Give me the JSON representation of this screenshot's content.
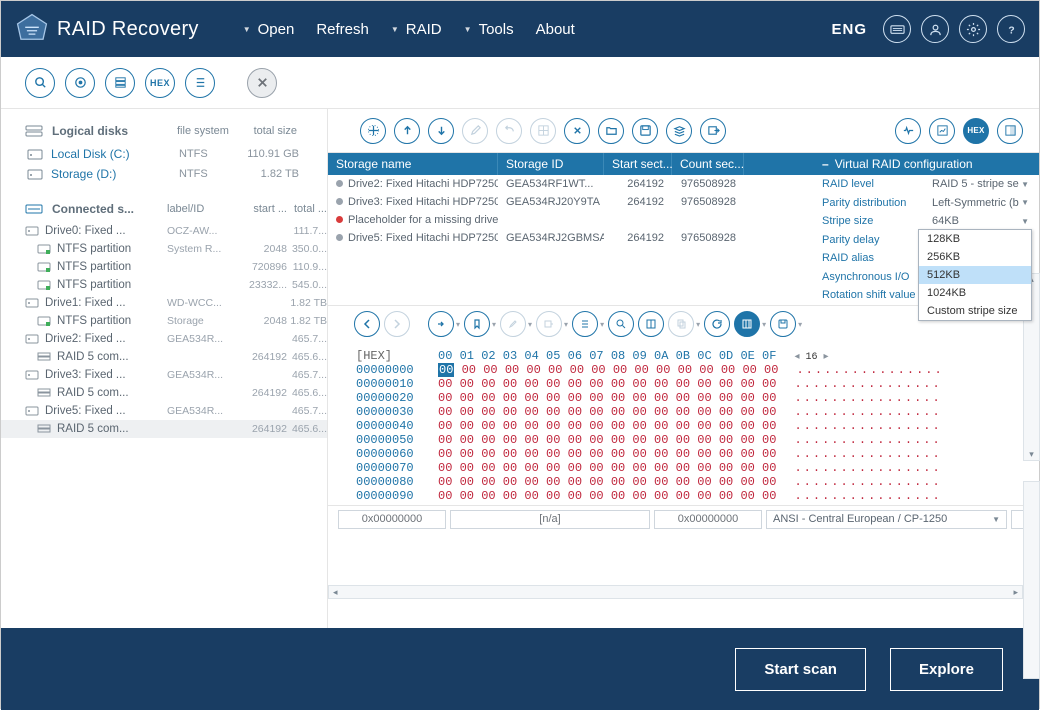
{
  "app": {
    "title": "RAID Recovery",
    "lang": "ENG"
  },
  "menu": {
    "open": "Open",
    "refresh": "Refresh",
    "raid": "RAID",
    "tools": "Tools",
    "about": "About"
  },
  "sidebar": {
    "logical_title": "Logical disks",
    "fs_col": "file system",
    "sz_col": "total size",
    "logical": [
      {
        "name": "Local Disk (C:)",
        "fs": "NTFS",
        "size": "110.91 GB"
      },
      {
        "name": "Storage (D:)",
        "fs": "NTFS",
        "size": "1.82 TB"
      }
    ],
    "connected_title": "Connected s...",
    "lid_col": "label/ID",
    "ss_col": "start ...",
    "tot_col": "total ...",
    "items": [
      {
        "t": "d",
        "name": "Drive0: Fixed ...",
        "id": "OCZ-AW...",
        "ss": "",
        "sz": "111.7..."
      },
      {
        "t": "p",
        "name": "NTFS partition",
        "id": "System R...",
        "ss": "2048",
        "sz": "350.0..."
      },
      {
        "t": "p",
        "name": "NTFS partition",
        "id": "",
        "ss": "720896",
        "sz": "110.9..."
      },
      {
        "t": "p",
        "name": "NTFS partition",
        "id": "",
        "ss": "23332...",
        "sz": "545.0..."
      },
      {
        "t": "d",
        "name": "Drive1: Fixed ...",
        "id": "WD-WCC...",
        "ss": "",
        "sz": "1.82 TB"
      },
      {
        "t": "p",
        "name": "NTFS partition",
        "id": "Storage",
        "ss": "2048",
        "sz": "1.82 TB"
      },
      {
        "t": "d",
        "name": "Drive2: Fixed ...",
        "id": "GEA534R...",
        "ss": "",
        "sz": "465.7..."
      },
      {
        "t": "r",
        "name": "RAID 5 com...",
        "id": "",
        "ss": "264192",
        "sz": "465.6..."
      },
      {
        "t": "d",
        "name": "Drive3: Fixed ...",
        "id": "GEA534R...",
        "ss": "",
        "sz": "465.7..."
      },
      {
        "t": "r",
        "name": "RAID 5 com...",
        "id": "",
        "ss": "264192",
        "sz": "465.6..."
      },
      {
        "t": "d",
        "name": "Drive5: Fixed ...",
        "id": "GEA534R...",
        "ss": "",
        "sz": "465.7..."
      },
      {
        "t": "r",
        "name": "RAID 5 com...",
        "id": "",
        "ss": "264192",
        "sz": "465.6...",
        "sel": true
      }
    ]
  },
  "grid": {
    "cols": {
      "name": "Storage name",
      "sid": "Storage ID",
      "start": "Start sect...",
      "count": "Count sec..."
    },
    "rows": [
      {
        "st": "g",
        "name": "Drive2: Fixed Hitachi HDP7250...",
        "sid": "GEA534RF1WT...",
        "start": "264192",
        "count": "976508928"
      },
      {
        "st": "g",
        "name": "Drive3: Fixed Hitachi HDP7250...",
        "sid": "GEA534RJ20Y9TA",
        "start": "264192",
        "count": "976508928"
      },
      {
        "st": "r",
        "name": "Placeholder for a missing drive",
        "sid": "",
        "start": "",
        "count": ""
      },
      {
        "st": "g",
        "name": "Drive5: Fixed Hitachi HDP7250...",
        "sid": "GEA534RJ2GBMSA",
        "start": "264192",
        "count": "976508928"
      }
    ]
  },
  "cfg": {
    "title": "Virtual RAID configuration",
    "rows": [
      {
        "k": "RAID level",
        "v": "RAID 5 - stripe se",
        "dd": true
      },
      {
        "k": "Parity distribution",
        "v": "Left-Symmetric (b",
        "dd": true
      },
      {
        "k": "Stripe size",
        "v": "64KB",
        "dd": true
      },
      {
        "k": "Parity delay",
        "v": ""
      },
      {
        "k": "RAID alias",
        "v": ""
      },
      {
        "k": "Asynchronous I/O",
        "v": ""
      },
      {
        "k": "Rotation shift value",
        "v": ""
      }
    ],
    "dropdown": [
      "128KB",
      "256KB",
      "512KB",
      "1024KB",
      "Custom stripe size"
    ],
    "dropdown_hl": 2
  },
  "hex": {
    "label": "[HEX]",
    "cols": "00 01 02 03 04 05 06 07 08 09 0A 0B 0C 0D 0E 0F",
    "width": "16",
    "offsets": [
      "00000000",
      "00000010",
      "00000020",
      "00000030",
      "00000040",
      "00000050",
      "00000060",
      "00000070",
      "00000080",
      "00000090"
    ],
    "zerobytes": "00 00 00 00 00 00 00 00 00 00 00 00 00 00 00 00",
    "asc": "................"
  },
  "footer": {
    "off1": "0x00000000",
    "na": "[n/a]",
    "off2": "0x00000000",
    "enc": "ANSI - Central European / CP-1250"
  },
  "bottom": {
    "scan": "Start scan",
    "explore": "Explore"
  },
  "hexbtn": "HEX"
}
